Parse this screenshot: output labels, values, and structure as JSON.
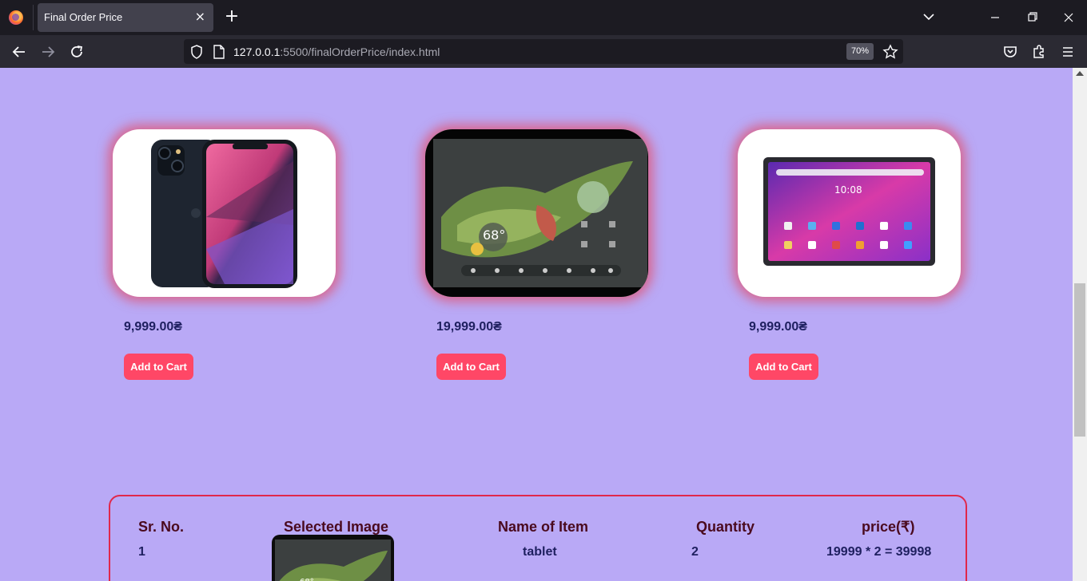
{
  "browser": {
    "tab_title": "Final Order Price",
    "tab_close": "×",
    "new_tab": "+",
    "url_host": "127.0.0.1",
    "url_path": ":5500/finalOrderPrice/index.html",
    "zoom": "70%"
  },
  "icons": {
    "back": "arrow-left-icon",
    "forward": "arrow-right-icon",
    "reload": "reload-icon",
    "shield": "shield-icon",
    "page": "page-icon",
    "bookmark": "star-icon",
    "pocket": "pocket-icon",
    "extensions": "puzzle-icon",
    "menu": "hamburger-menu-icon"
  },
  "products": [
    {
      "name": "iPhone",
      "price": "9,999.00₴",
      "button": "Add to Cart"
    },
    {
      "name": "Pixel Tablet",
      "price": "19,999.00₴",
      "button": "Add to Cart"
    },
    {
      "name": "Lenovo Tab",
      "price": "9,999.00₴",
      "button": "Add to Cart"
    }
  ],
  "order": {
    "headers": [
      "Sr. No.",
      "Selected Image",
      "Name of Item",
      "Quantity",
      "price(₹)"
    ],
    "rows": [
      {
        "sr": "1",
        "name": "tablet",
        "quantity": "2",
        "price": "19999 * 2 = 39998"
      }
    ]
  },
  "colors": {
    "page_bg": "#b9a9f6",
    "button": "#ff4766",
    "price_text": "#1f2060",
    "order_border": "#e0284b"
  }
}
